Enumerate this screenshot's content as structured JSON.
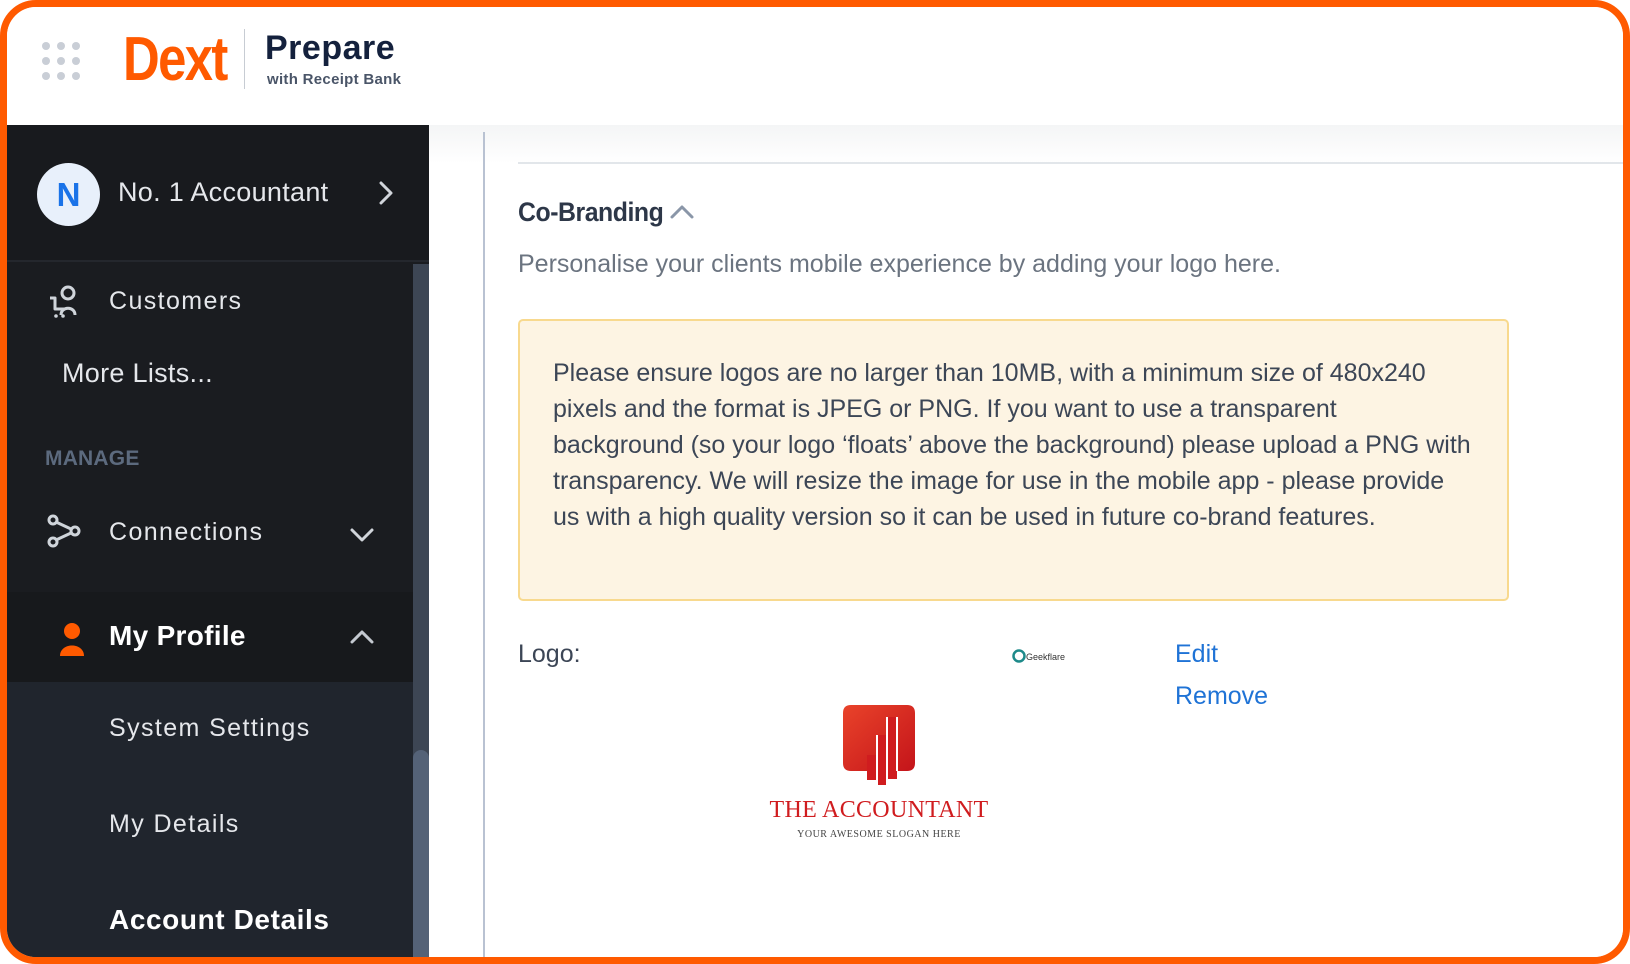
{
  "brand": {
    "logo_text": "Dext",
    "product_name": "Prepare",
    "product_sub": "with Receipt Bank",
    "accent_color": "#ff5a00"
  },
  "sidebar": {
    "account": {
      "avatar_initial": "N",
      "name": "No. 1 Accountant"
    },
    "items": [
      {
        "label": "Customers",
        "icon": "customers-icon"
      },
      {
        "label": "More Lists..."
      }
    ],
    "manage_section": "MANAGE",
    "connections": {
      "label": "Connections",
      "icon": "connections-icon",
      "expanded": false
    },
    "my_profile": {
      "label": "My Profile",
      "icon": "person-icon",
      "expanded": true,
      "subitems": [
        {
          "label": "System Settings",
          "active": false
        },
        {
          "label": "My Details",
          "active": false
        },
        {
          "label": "Account Details",
          "active": true
        }
      ]
    }
  },
  "main": {
    "section_title": "Co-Branding",
    "section_description": "Personalise your clients mobile experience by adding your logo here.",
    "notice": "Please ensure logos are no larger than 10MB, with a minimum size of 480x240 pixels and the format is JPEG or PNG. If you want to use a transparent background (so your logo ‘floats’ above the background) please upload a PNG with transparency. We will resize the image for use in the mobile app - please provide us with a high quality version so it can be used in future co-brand features.",
    "logo_label": "Logo:",
    "small_logo_text": "Geekflare",
    "edit_label": "Edit",
    "remove_label": "Remove",
    "uploaded_logo": {
      "title": "THE ACCOUNTANT",
      "slogan": "YOUR AWESOME SLOGAN HERE"
    }
  }
}
